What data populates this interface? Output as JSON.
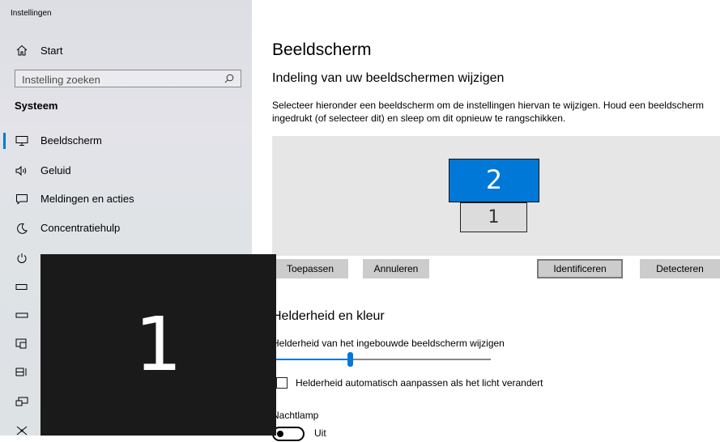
{
  "window": {
    "title": "Instellingen"
  },
  "sidebar": {
    "home_label": "Start",
    "search_placeholder": "Instelling zoeken",
    "section_title": "Systeem",
    "items": [
      {
        "label": "Beeldscherm",
        "icon": "monitor-icon",
        "active": true
      },
      {
        "label": "Geluid",
        "icon": "speaker-icon"
      },
      {
        "label": "Meldingen en acties",
        "icon": "notification-icon"
      },
      {
        "label": "Concentratiehulp",
        "icon": "moon-icon"
      },
      {
        "label": "",
        "icon": "power-icon"
      },
      {
        "label": "",
        "icon": "battery-icon"
      },
      {
        "label": "",
        "icon": "storage-icon"
      },
      {
        "label": "",
        "icon": "tablet-icon"
      },
      {
        "label": "",
        "icon": "multitasking-icon"
      },
      {
        "label": "",
        "icon": "project-icon"
      },
      {
        "label": "",
        "icon": "shared-experiences-icon"
      }
    ]
  },
  "identify_overlay": {
    "number": "1"
  },
  "main": {
    "title": "Beeldscherm",
    "subtitle": "Indeling van uw beeldschermen wijzigen",
    "description": "Selecteer hieronder een beeldscherm om de instellingen hiervan te wijzigen. Houd een beeldscherm ingedrukt (of selecteer dit) en sleep om dit opnieuw te rangschikken.",
    "monitors": {
      "primary_number": "2",
      "secondary_number": "1"
    },
    "buttons": {
      "apply": "Toepassen",
      "cancel": "Annuleren",
      "identify": "Identificeren",
      "detect": "Detecteren"
    },
    "brightness": {
      "heading": "Helderheid en kleur",
      "slider_label": "Helderheid van het ingebouwde beeldscherm wijzigen",
      "level_percent": 35,
      "auto_label": "Helderheid automatisch aanpassen als het licht verandert",
      "auto_checked": false
    },
    "night_light": {
      "label": "Nachtlamp",
      "state": "Uit"
    }
  },
  "colors": {
    "accent": "#0078d7",
    "sidebar_bg": "#e0e2e6",
    "overlay": "#1a1a1a"
  }
}
